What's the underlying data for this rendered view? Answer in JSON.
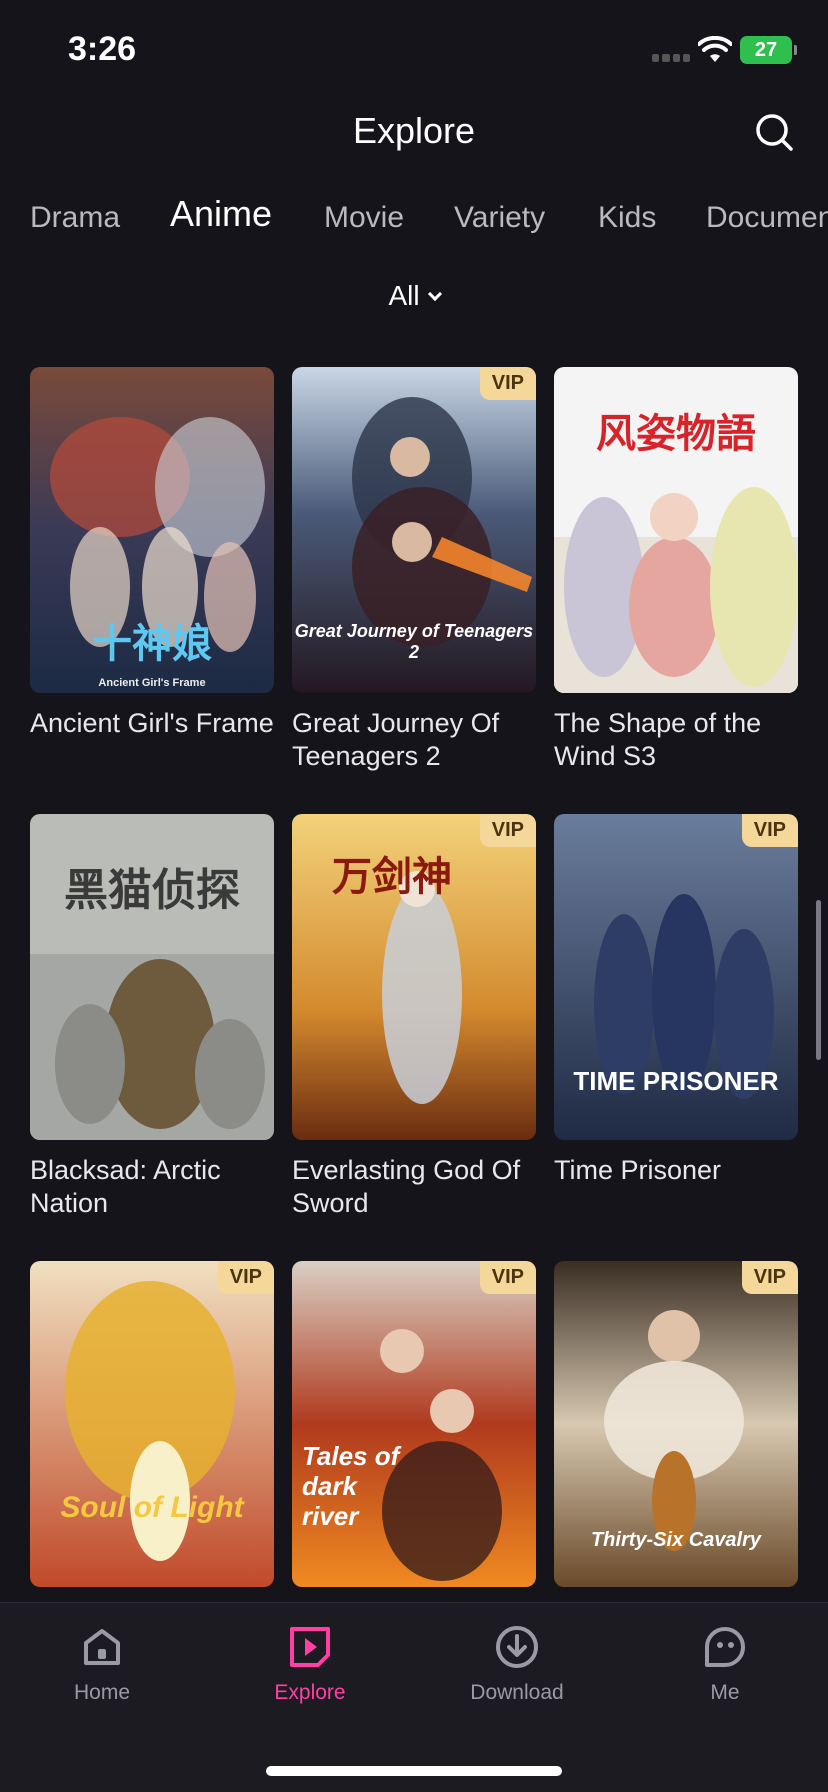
{
  "status": {
    "time": "3:26",
    "battery": "27"
  },
  "header": {
    "title": "Explore"
  },
  "tabs": [
    "Drama",
    "Anime",
    "Movie",
    "Variety",
    "Kids",
    "Documen"
  ],
  "active_tab": "Anime",
  "filter": {
    "label": "All"
  },
  "badge": "VIP",
  "items": [
    {
      "title": "Ancient Girl's Frame",
      "vip": false,
      "poster_text": "Ancient Girl's Frame"
    },
    {
      "title": "Great Journey Of Teenagers 2",
      "vip": true,
      "poster_text": "Great Journey of Teenagers 2"
    },
    {
      "title": "The Shape of the Wind S3",
      "vip": false,
      "poster_text": "风姿物語"
    },
    {
      "title": "Blacksad: Arctic Nation",
      "vip": false,
      "poster_text": "黑猫侦探"
    },
    {
      "title": "Everlasting God Of Sword",
      "vip": true,
      "poster_text": "万剑神"
    },
    {
      "title": "Time Prisoner",
      "vip": true,
      "poster_text": "TIME PRISONER"
    },
    {
      "title": "",
      "vip": true,
      "poster_text": "Soul of Light"
    },
    {
      "title": "",
      "vip": true,
      "poster_text": "Tales of dark river"
    },
    {
      "title": "",
      "vip": true,
      "poster_text": "Thirty-Six Cavalry"
    }
  ],
  "nav": [
    {
      "label": "Home",
      "icon": "home-icon"
    },
    {
      "label": "Explore",
      "icon": "explore-icon"
    },
    {
      "label": "Download",
      "icon": "download-icon"
    },
    {
      "label": "Me",
      "icon": "me-icon"
    }
  ],
  "colors": {
    "accent": "#ff3fa4",
    "vip_bg": "#f6d79a",
    "background": "#14141a"
  }
}
